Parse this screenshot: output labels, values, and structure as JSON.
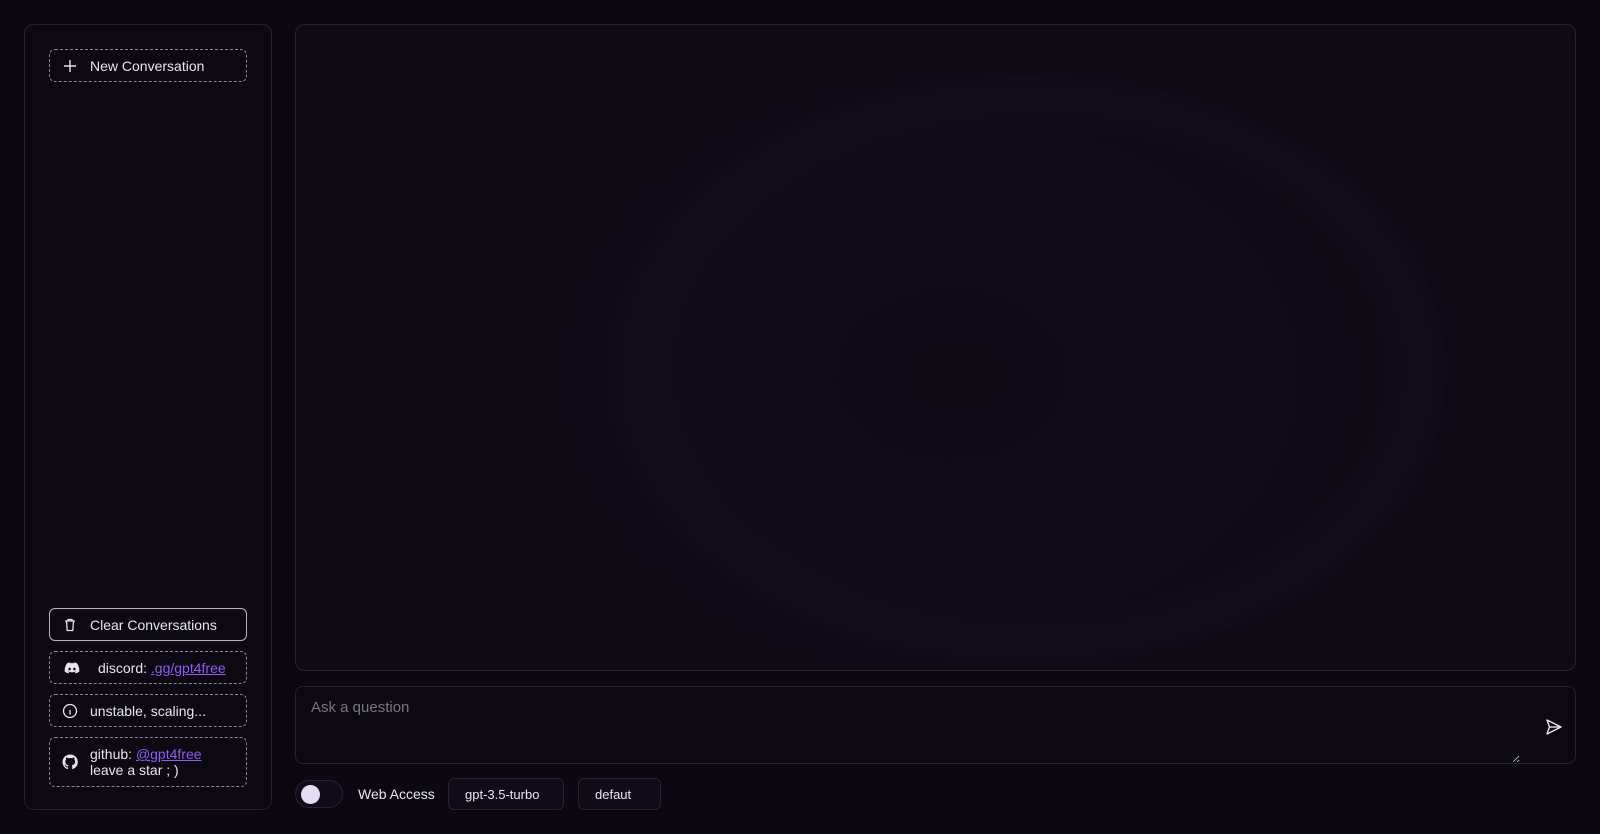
{
  "sidebar": {
    "new_conversation": "New Conversation",
    "clear_conversations": "Clear Conversations",
    "discord_prefix": "discord:",
    "discord_link": ".gg/gpt4free",
    "status": "unstable, scaling...",
    "github_prefix": "github:",
    "github_link": "@gpt4free",
    "github_note": "leave a star ; )"
  },
  "input": {
    "placeholder": "Ask a question"
  },
  "controls": {
    "web_access_label": "Web Access",
    "web_access_enabled": false,
    "model": "gpt-3.5-turbo",
    "jailbreak": "defaut"
  },
  "icons": {
    "new": "plus-icon",
    "clear": "trash-icon",
    "discord": "discord-icon",
    "info": "info-icon",
    "github": "github-icon",
    "send": "send-icon"
  },
  "colors": {
    "background": "#0b0812",
    "link": "#8e5cf6",
    "border": "#26222e",
    "toggle_knob": "#e6dcf6"
  }
}
